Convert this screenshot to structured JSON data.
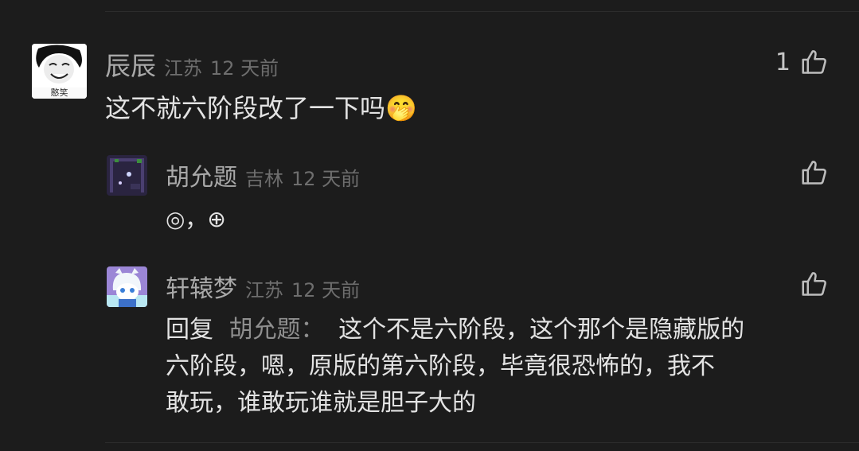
{
  "comments": [
    {
      "name": "辰辰",
      "location": "江苏",
      "time": "12 天前",
      "likes": "1",
      "avatar_caption": "憨笑",
      "text": "这不就六阶段改了一下吗",
      "emoji": "🤭"
    },
    {
      "name": "胡允题",
      "location": "吉林",
      "time": "12 天前",
      "likes": "",
      "text": "◎，⊕"
    },
    {
      "name": "轩辕梦",
      "location": "江苏",
      "time": "12 天前",
      "likes": "",
      "reply_prefix": "回复",
      "reply_to": "胡允题：",
      "text_lines": [
        "这个不是六阶段，这个那个是隐藏版的",
        "六阶段，嗯，原版的第六阶段，毕竟很恐怖的，我不",
        "敢玩，谁敢玩谁就是胆子大的"
      ]
    }
  ],
  "icons": {
    "like": "thumbs-up-icon"
  }
}
